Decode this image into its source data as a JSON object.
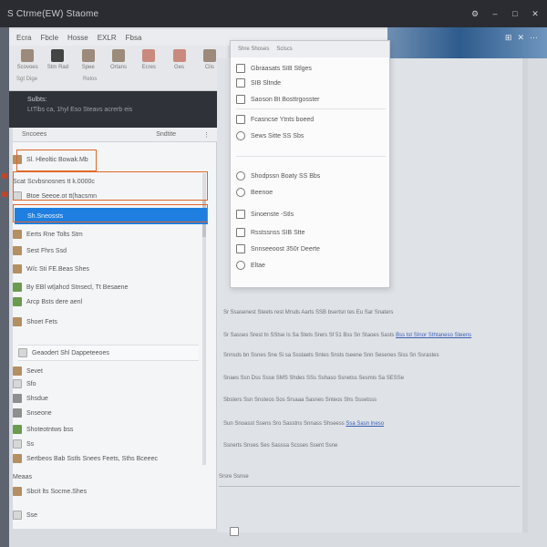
{
  "window": {
    "title": "S Ctrme(EW) Staome"
  },
  "ribbon_tabs": [
    "Ecra",
    "Fbcle",
    "Hosse",
    "EXLR",
    "Fbsa"
  ],
  "ribbon_buttons": [
    {
      "label": "Scovoes",
      "icon": "folder-icon"
    },
    {
      "label": "Stm Rad",
      "icon": "file-icon"
    },
    {
      "label": "Spee",
      "icon": "document-icon"
    },
    {
      "label": "Ortans",
      "icon": "gear-icon"
    },
    {
      "label": "Ecres",
      "icon": "format-icon"
    },
    {
      "label": "Ges",
      "icon": "paint-icon"
    },
    {
      "label": "Ciis",
      "icon": "insert-icon"
    }
  ],
  "ribbon_sub": [
    "Sgt Dige",
    "Relos"
  ],
  "darkband": {
    "line1": "Sulbts:",
    "line2": "LtTlbs ca, 1hyl Eso Steavs acrerb eis"
  },
  "columns": {
    "name": "Sncoees",
    "type": "Sndtite",
    "size": "Stnnues"
  },
  "sidebar_items": [
    {
      "label": "Sl. Hleoltic Bowak.Mb",
      "icon": "folder-icon"
    },
    {
      "label": "Scat Scvbsnosnes tt k.0000c",
      "icon": "folder-icon"
    },
    {
      "label": "Btoe Seeoe.ot tt(hacsmn",
      "icon": "document-icon"
    },
    {
      "label": "Sh.Sneossts",
      "icon": "folder-icon",
      "selected": true
    },
    {
      "label": "Eerts Rne Tolts Stm",
      "icon": "folder-icon"
    },
    {
      "label": "Sest Fhrs Ssd",
      "icon": "folder-icon"
    },
    {
      "label": "W/c Sti FE.Beas Shes",
      "icon": "folder-icon"
    },
    {
      "label": "By EBl wt|ahcd Stnsecl, Tt Besaene",
      "icon": "image-icon"
    },
    {
      "label": "Arcp Bsts dere aenl",
      "icon": "image-icon"
    },
    {
      "label": "Shoet Fets",
      "icon": "folder-icon"
    },
    {
      "label": "Geaodert Shl Dappeteeoes",
      "icon": "file-icon"
    },
    {
      "label": "Sevet",
      "icon": "folder-icon"
    },
    {
      "label": "Sfo",
      "icon": "file-icon"
    },
    {
      "label": "Shsdue",
      "icon": "folder-icon"
    },
    {
      "label": "Snseone",
      "icon": "folder-icon"
    },
    {
      "label": "Shoteotntws bss",
      "icon": "image-icon"
    },
    {
      "label": "Ss",
      "icon": "file-icon"
    },
    {
      "label": "Sertbeos Bab Sstls Snees Feets, Sths Bceeec",
      "icon": "folder-icon"
    },
    {
      "label": "Meaas",
      "icon": "document-icon"
    },
    {
      "label": "Sbcit lts Socme.Shes",
      "icon": "folder-icon"
    },
    {
      "label": "Sse",
      "icon": "file-icon"
    }
  ],
  "dropdown": {
    "header": [
      "Shre Shoses",
      "Sclscs"
    ],
    "items": [
      {
        "label": "Gbraasats SIB Stlges",
        "icon": "window-icon"
      },
      {
        "label": "SIB Sltnde",
        "icon": "file-icon"
      },
      {
        "label": "Saoson Bt Bosttrgosster",
        "icon": "file-icon"
      },
      {
        "label": "Fcasncse Ytnts boeed",
        "icon": "window-icon"
      },
      {
        "label": "Sews Sitte SS Sbs",
        "icon": "radio-icon"
      },
      {
        "label": "Shodpssn Boaty SS Bbs",
        "icon": "radio-icon"
      },
      {
        "label": "Beenoe",
        "icon": "radio-icon"
      },
      {
        "label": "Sinoenste -Stls",
        "icon": "window-icon"
      },
      {
        "label": "Rsstssnss SIB Stte",
        "icon": "window-icon"
      },
      {
        "label": "Snnseeoost 350r Deerte",
        "icon": "window-icon"
      },
      {
        "label": "Eltae",
        "icon": "radio-icon"
      }
    ]
  },
  "doc_lines": [
    {
      "text": "Sr Ssasenest Steets rest Mrsds Aarts SSB bsertsn tes Eu Sar Snaters",
      "link": ""
    },
    {
      "text": "Sr Sasses Srest tn SStse Is Sa Stets Srers Sf 51 Bss Sn Staoes Sasts",
      "link": "Bss tst SInor Sthtaneso Steens"
    },
    {
      "text": "Snnsds bn Ssnes Sne Si sa Ssstaets Sntes Snsts tseene Snn Sesenes Siss Sn Ssrastes",
      "link": ""
    },
    {
      "text": "Snaes Ssn Dss Ssse SMS Shdes SSs Sshaso Ssnetss Sesmis Sa SESSe",
      "link": ""
    },
    {
      "text": "Sbsters Ssn Snsteos Sos Srsaaa Sasnes Snteos Shs Sssetsss",
      "link": ""
    },
    {
      "text": "Sun Snoasst Ssens Sro Sasstns Snnass Shseess",
      "link": "Ssa Sasn lneso"
    },
    {
      "text": "Ssnerts Snses Ses Sasssa Scsses Ssent Ssne",
      "link": ""
    },
    {
      "text": "Srsre Ssnse",
      "link": ""
    }
  ]
}
